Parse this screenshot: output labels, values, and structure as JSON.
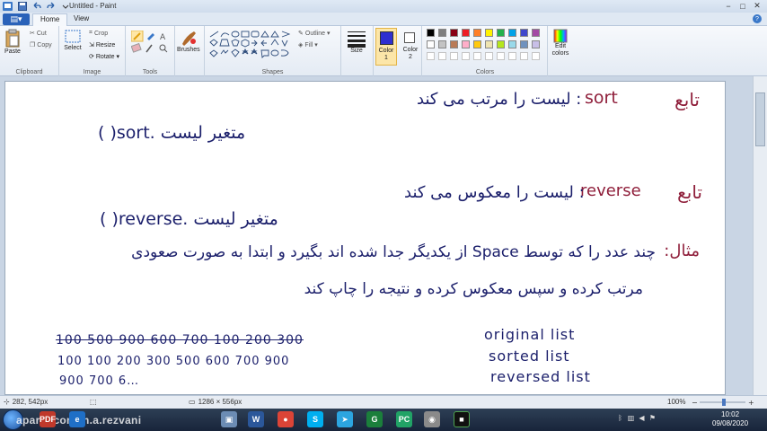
{
  "window": {
    "title": "Untitled - Paint",
    "quick_access": [
      "save-icon",
      "undo-icon",
      "redo-icon"
    ],
    "controls": [
      "−",
      "□",
      "✕"
    ]
  },
  "tabs": {
    "file": "▤▾",
    "items": [
      "Home",
      "View"
    ],
    "active": "Home",
    "help": "?"
  },
  "ribbon": {
    "clipboard": {
      "label": "Clipboard",
      "paste": "Paste",
      "cut": "Cut",
      "copy": "Copy"
    },
    "image": {
      "label": "Image",
      "select": "Select",
      "crop": "Crop",
      "resize": "Resize",
      "rotate": "Rotate ▾"
    },
    "tools": {
      "label": "Tools"
    },
    "brushes": {
      "label": "Brushes"
    },
    "shapes": {
      "label": "Shapes",
      "outline": "Outline ▾",
      "fill": "Fill ▾"
    },
    "size": {
      "label": "Size"
    },
    "color1": {
      "label": "Color\n1",
      "value": "#2f2fd0"
    },
    "color2": {
      "label": "Color\n2",
      "value": "#ffffff"
    },
    "colors": {
      "label": "Colors",
      "palette_row1": [
        "#000000",
        "#7f7f7f",
        "#880015",
        "#ed1c24",
        "#ff7f27",
        "#fff200",
        "#22b14c",
        "#00a2e8",
        "#3f48cc",
        "#a349a4"
      ],
      "palette_row2": [
        "#ffffff",
        "#c3c3c3",
        "#b97a57",
        "#ffaec9",
        "#ffc90e",
        "#efe4b0",
        "#b5e61d",
        "#99d9ea",
        "#7092be",
        "#c8bfe7"
      ]
    },
    "edit_colors": "Edit\ncolors"
  },
  "canvas": {
    "lines": {
      "sort_title_fa": "تابع",
      "sort_title_en": "sort",
      "sort_desc": ": لیست را مرتب می کند",
      "sort_code": "متغیر لیست .sort( )",
      "reverse_title_fa": "تابع",
      "reverse_title_en": "reverse",
      "reverse_desc": ": لیست را معکوس می کند",
      "reverse_code": "متغیر لیست .reverse( )",
      "example_label": ":مثال",
      "example_text1": "چند عدد را که توسط Space از یکدیگر جدا شده اند بگیرد و ابتدا به صورت صعودی",
      "example_text2": "مرتب کرده و سپس معکوس کرده و نتیجه را چاپ کند",
      "original_nums": "100   500   900   600   700   100   200   300",
      "sorted_nums": "100   100   200   300   500   600   700   900",
      "reversed_nums": "900   700   6…",
      "original_label": "original list",
      "sorted_label": "sorted list",
      "reversed_label": "reversed list"
    }
  },
  "status": {
    "cursor": "282, 542px",
    "size": "1286 × 556px",
    "zoom": "100%"
  },
  "taskbar": {
    "watermark": "aparat.com/m.a.rezvani",
    "apps": [
      "PDF",
      "e",
      "▣",
      "W",
      "●",
      "S",
      "➤",
      "G",
      "PC",
      "◉",
      "■"
    ],
    "clock_time": "10:02",
    "clock_date": "09/08/2020"
  }
}
